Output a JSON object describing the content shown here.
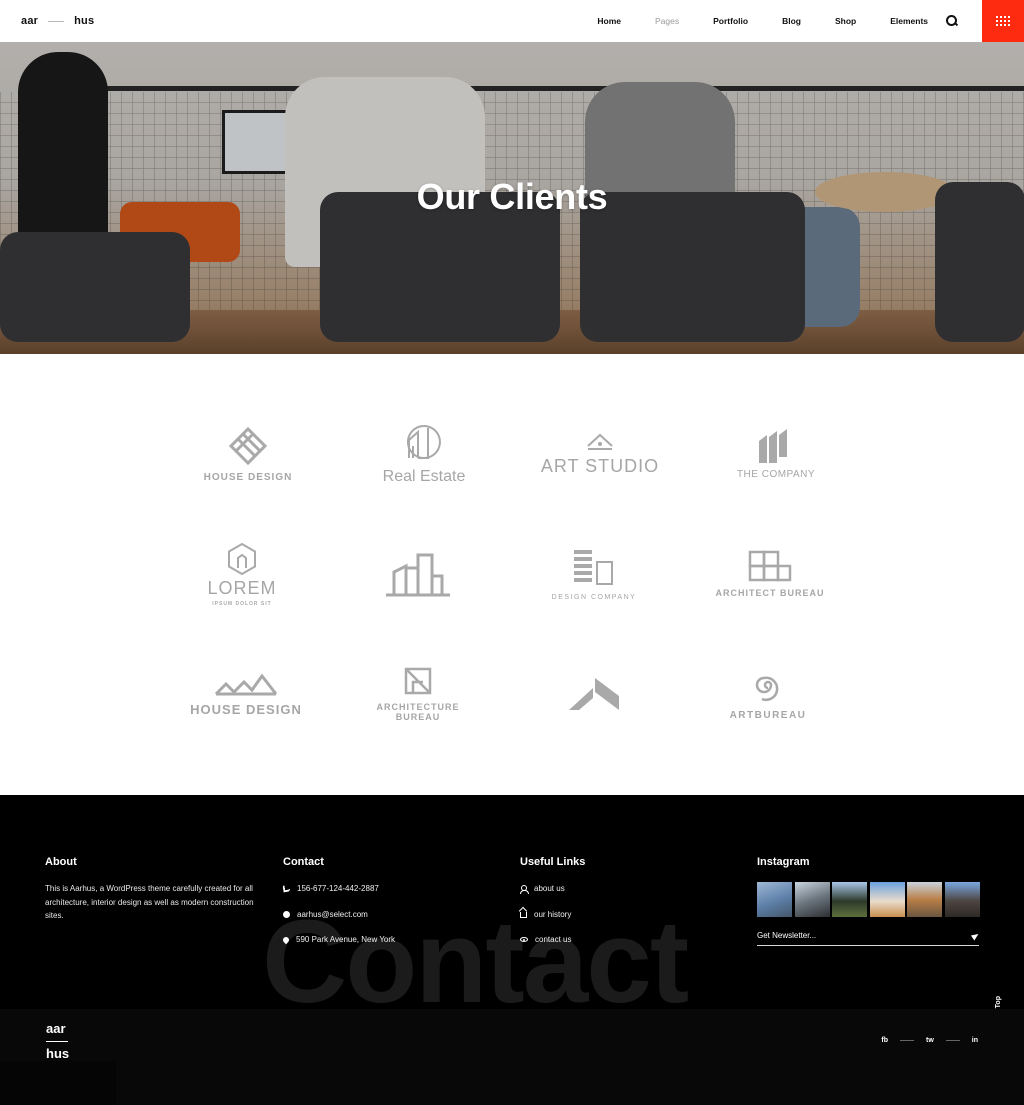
{
  "header": {
    "logo_left": "aar",
    "logo_right": "hus",
    "nav": [
      {
        "label": "Home",
        "active": true
      },
      {
        "label": "Pages",
        "muted": true
      },
      {
        "label": "Portfolio"
      },
      {
        "label": "Blog"
      },
      {
        "label": "Shop"
      },
      {
        "label": "Elements"
      }
    ],
    "menu_color": "#ff2b10"
  },
  "hero": {
    "title": "Our Clients"
  },
  "clients": [
    {
      "name": "HOUSE DESIGN",
      "icon": "striped-diamond-icon"
    },
    {
      "name": "Real Estate",
      "icon": "house-circle-icon"
    },
    {
      "name": "ART STUDIO",
      "icon": "house-dot-icon"
    },
    {
      "name": "THE COMPANY",
      "icon": "stacked-houses-icon"
    },
    {
      "name": "LOREM",
      "sub": "IPSUM DOLOR SIT",
      "icon": "hexagon-icon"
    },
    {
      "name": "",
      "icon": "city-buildings-icon"
    },
    {
      "name": "DESIGN COMPANY",
      "icon": "bookshelf-icon"
    },
    {
      "name": "ARCHITECT BUREAU",
      "icon": "grid-blocks-icon"
    },
    {
      "name": "HOUSE DESIGN",
      "icon": "mountain-roofs-icon"
    },
    {
      "name": "ARCHITECTURE",
      "sub": "BUREAU",
      "icon": "framed-square-icon"
    },
    {
      "name": "",
      "icon": "chevron-wing-icon"
    },
    {
      "name": "ARTBUREAU",
      "icon": "spiral-icon"
    }
  ],
  "footer": {
    "watermark": "Contact",
    "about": {
      "title": "About",
      "text": "This is Aarhus, a WordPress theme carefully created for all architecture, interior design as well as modern construction sites."
    },
    "contact": {
      "title": "Contact",
      "phone": "156-677-124-442-2887",
      "email": "aarhus@select.com",
      "address": "590 Park Avenue, New York"
    },
    "links": {
      "title": "Useful Links",
      "items": [
        "about us",
        "our history",
        "contact us"
      ]
    },
    "instagram": {
      "title": "Instagram",
      "newsletter_placeholder": "Get Newsletter..."
    },
    "logo_top": "aar",
    "logo_bottom": "hus",
    "social": [
      "fb",
      "tw",
      "in"
    ],
    "back_to_top": "Back To Top"
  }
}
